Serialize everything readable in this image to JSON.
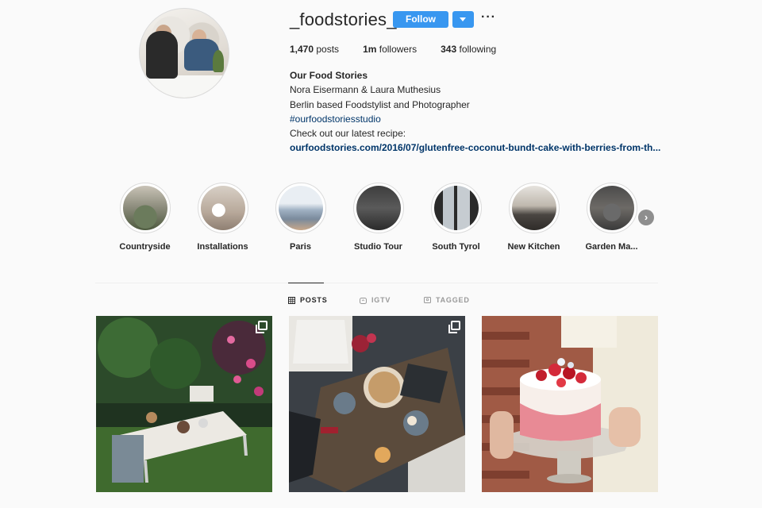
{
  "profile": {
    "username": "_foodstories_",
    "follow_label": "Follow",
    "more_label": "···",
    "stats": {
      "posts_count": "1,470",
      "posts_label": "posts",
      "followers_count": "1m",
      "followers_label": "followers",
      "following_count": "343",
      "following_label": "following"
    },
    "bio": {
      "name": "Our Food Stories",
      "line1": "Nora Eisermann & Laura Muthesius",
      "line2": "Berlin based Foodstylist and Photographer",
      "hashtag": "#ourfoodstoriesstudio",
      "line3": "Check out our latest recipe:",
      "link": "ourfoodstories.com/2016/07/glutenfree-coconut-bundt-cake-with-berries-from-th..."
    }
  },
  "highlights": [
    {
      "label": "Countryside"
    },
    {
      "label": "Installations"
    },
    {
      "label": "Paris"
    },
    {
      "label": "Studio Tour"
    },
    {
      "label": "South Tyrol"
    },
    {
      "label": "New Kitchen"
    },
    {
      "label": "Garden Ma..."
    }
  ],
  "highlights_next_label": "›",
  "tabs": [
    {
      "label": "POSTS",
      "icon": "grid-icon"
    },
    {
      "label": "IGTV",
      "icon": "igtv-icon"
    },
    {
      "label": "TAGGED",
      "icon": "tagged-icon"
    }
  ],
  "colors": {
    "accent": "#3897f0",
    "link": "#003569",
    "background": "#fafafa"
  }
}
